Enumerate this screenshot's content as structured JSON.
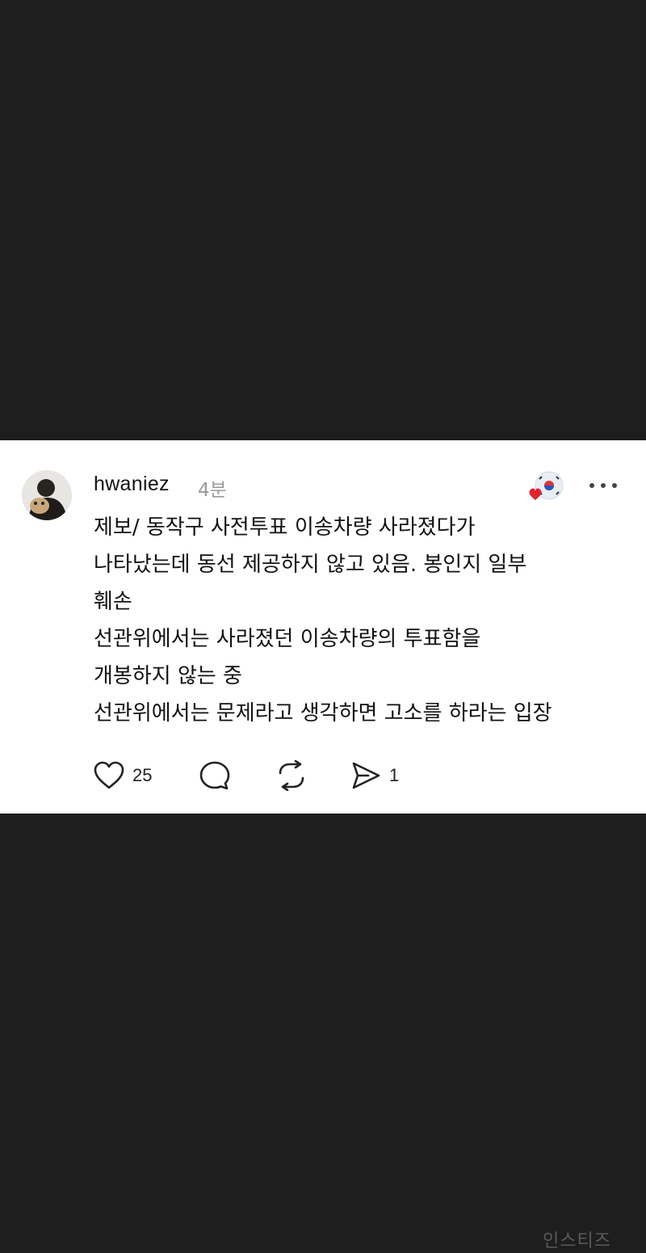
{
  "post": {
    "username": "hwaniez",
    "time": "4분",
    "lines": [
      "제보/ 동작구 사전투표 이송차량 사라졌다가",
      "나타났는데 동선 제공하지 않고 있음. 봉인지 일부",
      "훼손",
      "선관위에서는 사라졌던 이송차량의 투표함을",
      "개봉하지 않는 중",
      "선관위에서는 문제라고 생각하면 고소를 하라는 입장"
    ],
    "likes": "25",
    "shares": "1"
  },
  "watermark": "인스티즈",
  "icons": {
    "like": "heart-icon",
    "comment": "comment-bubble-icon",
    "repost": "repost-icon",
    "share": "send-icon",
    "more": "more-icon"
  },
  "colors": {
    "background": "#1e1e1e",
    "card": "#ffffff",
    "heart_badge": "#e0242f"
  }
}
